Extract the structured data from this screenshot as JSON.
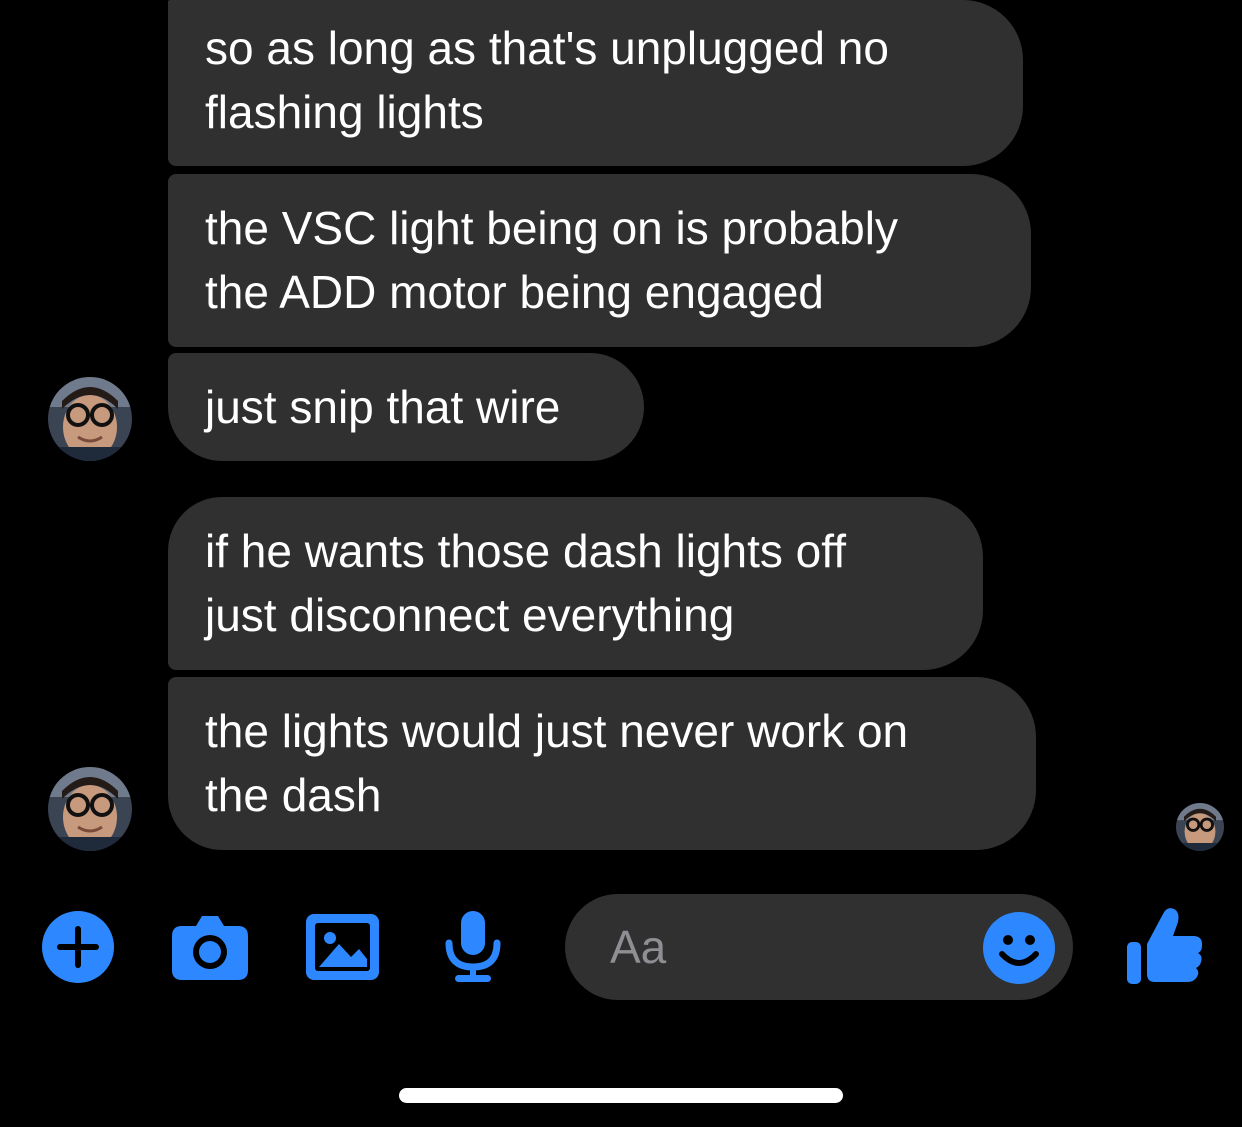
{
  "messages": [
    {
      "lines": [
        "so as long as that's unplugged no",
        "flashing lights"
      ]
    },
    {
      "lines": [
        "the VSC light being on is probably",
        "the ADD motor being engaged"
      ]
    },
    {
      "lines": [
        "just snip that wire"
      ]
    },
    {
      "lines": [
        "if he wants those dash lights off",
        "just disconnect everything"
      ]
    },
    {
      "lines": [
        "the lights would just never work on",
        "the dash"
      ]
    }
  ],
  "composer": {
    "input_placeholder": "Aa",
    "icons": [
      "plus-icon",
      "camera-icon",
      "gallery-icon",
      "microphone-icon",
      "emoji-icon",
      "thumbs-up-icon"
    ]
  },
  "colors": {
    "background": "#000000",
    "bubble": "#303030",
    "text": "#ffffff",
    "accent": "#2d88ff",
    "placeholder": "#8e8e93"
  }
}
